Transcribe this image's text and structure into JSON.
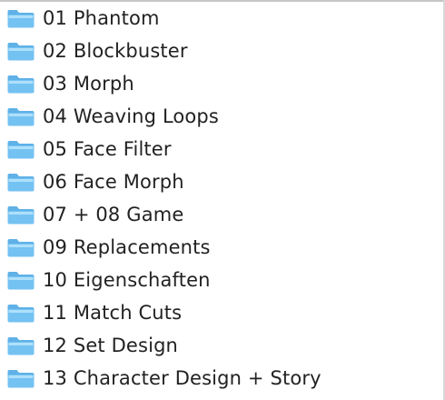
{
  "folders": [
    {
      "name": "01 Phantom",
      "icon": "folder-icon"
    },
    {
      "name": "02 Blockbuster",
      "icon": "folder-icon"
    },
    {
      "name": "03 Morph",
      "icon": "folder-icon"
    },
    {
      "name": "04 Weaving Loops",
      "icon": "folder-icon"
    },
    {
      "name": "05 Face Filter",
      "icon": "folder-icon"
    },
    {
      "name": "06 Face Morph",
      "icon": "folder-icon"
    },
    {
      "name": "07 + 08 Game",
      "icon": "folder-icon"
    },
    {
      "name": "09 Replacements",
      "icon": "folder-icon"
    },
    {
      "name": "10 Eigenschaften",
      "icon": "folder-icon"
    },
    {
      "name": "11 Match Cuts",
      "icon": "folder-icon"
    },
    {
      "name": "12 Set Design",
      "icon": "folder-icon"
    },
    {
      "name": "13 Character Design + Story",
      "icon": "folder-icon"
    }
  ],
  "colors": {
    "folder_body": "#74c2f2",
    "folder_tab": "#5fb1e7",
    "folder_highlight": "#aee0fb",
    "text": "#222222"
  }
}
